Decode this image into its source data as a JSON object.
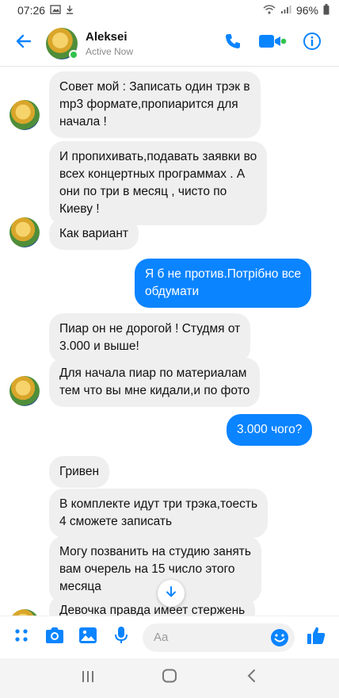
{
  "status_bar": {
    "time": "07:26",
    "battery": "96%"
  },
  "header": {
    "name": "Aleksei",
    "status": "Active Now"
  },
  "messages": [
    {
      "side": "in",
      "text": "Совет мой : Записать один трэк в\nmp3 формате,пропиарится для\nначала !"
    },
    {
      "side": "in",
      "text": "И пропихивать,подавать заявки во\nвсех концертных программах . А\nони по три в месяц , чисто по\nКиеву !"
    },
    {
      "side": "in",
      "text": "Как вариант"
    },
    {
      "side": "out",
      "text": "Я б не против.Потрібно все\nобдумати"
    },
    {
      "side": "in",
      "text": "Пиар он не дорогой ! Студмя от\n3.000 и выше!"
    },
    {
      "side": "in",
      "text": "Для начала пиар по материалам\nтем что вы мне кидали,и по фото"
    },
    {
      "side": "out",
      "text": "3.000 чого?"
    },
    {
      "side": "in",
      "text": "Гривен"
    },
    {
      "side": "in",
      "text": "В комплекте идут три трэка,тоесть\n4 сможете записать"
    },
    {
      "side": "in",
      "text": "Могу позванить на студию занять\nвам очерель на 15 число этого\nмесяца"
    },
    {
      "side": "in",
      "text": "Девочка правда имеет стержень"
    }
  ],
  "composer": {
    "placeholder": "Aa"
  },
  "colors": {
    "accent": "#0b84ff",
    "incoming_bubble": "#efefef",
    "online": "#32c24d"
  },
  "icons": {
    "back": "arrow-left-icon",
    "call": "phone-icon",
    "video": "video-camera-icon",
    "info": "info-icon",
    "more": "dots-grid-icon",
    "camera": "camera-icon",
    "gallery": "image-icon",
    "mic": "microphone-icon",
    "emoji": "smiley-icon",
    "like": "thumbs-up-icon",
    "scroll_down": "arrow-down-icon"
  }
}
